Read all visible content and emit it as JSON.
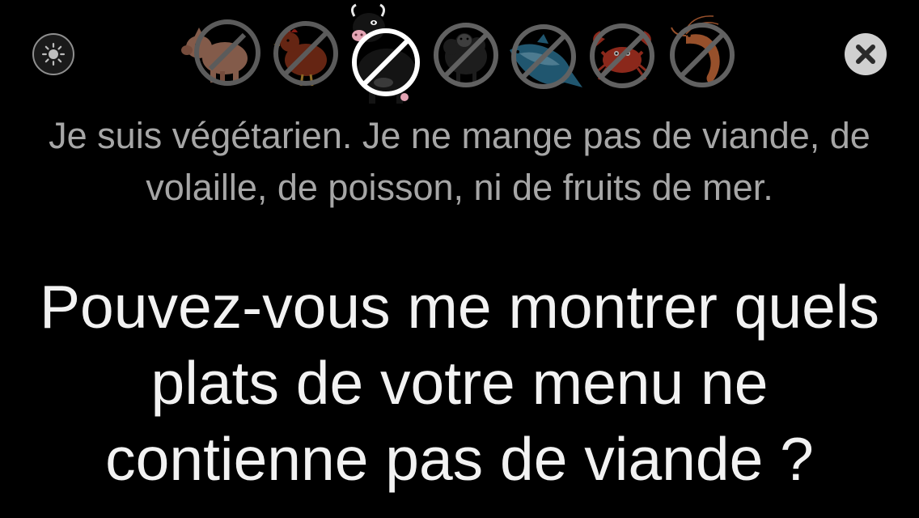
{
  "toolbar": {
    "brightness_icon": "sun-icon",
    "close_icon": "close-icon"
  },
  "restrictions": [
    {
      "name": "pig",
      "icon": "pig-icon",
      "selected": false
    },
    {
      "name": "chicken",
      "icon": "chicken-icon",
      "selected": false
    },
    {
      "name": "cow",
      "icon": "cow-icon",
      "selected": true
    },
    {
      "name": "sheep",
      "icon": "sheep-icon",
      "selected": false
    },
    {
      "name": "fish",
      "icon": "fish-icon",
      "selected": false
    },
    {
      "name": "crab",
      "icon": "crab-icon",
      "selected": false
    },
    {
      "name": "shrimp",
      "icon": "shrimp-icon",
      "selected": false
    }
  ],
  "message": {
    "statement": "Je suis végétarien. Je ne mange pas de viande, de volaille, de poisson, ni de fruits de mer.",
    "question": "Pouvez-vous me montrer quels plats de votre menu ne contienne pas de viande ?"
  },
  "colors": {
    "background": "#000000",
    "statement_text": "#a6a6a6",
    "question_text": "#f2f2f2",
    "ban_ring_inactive": "#8c8c8c",
    "ban_ring_active": "#ffffff",
    "pig": "#c98d72",
    "chicken": "#9b3a1e",
    "cow": "#141414",
    "sheep": "#2a2a2a",
    "fish": "#2f7ca0",
    "crab": "#c83a28",
    "shrimp": "#d9733e"
  }
}
